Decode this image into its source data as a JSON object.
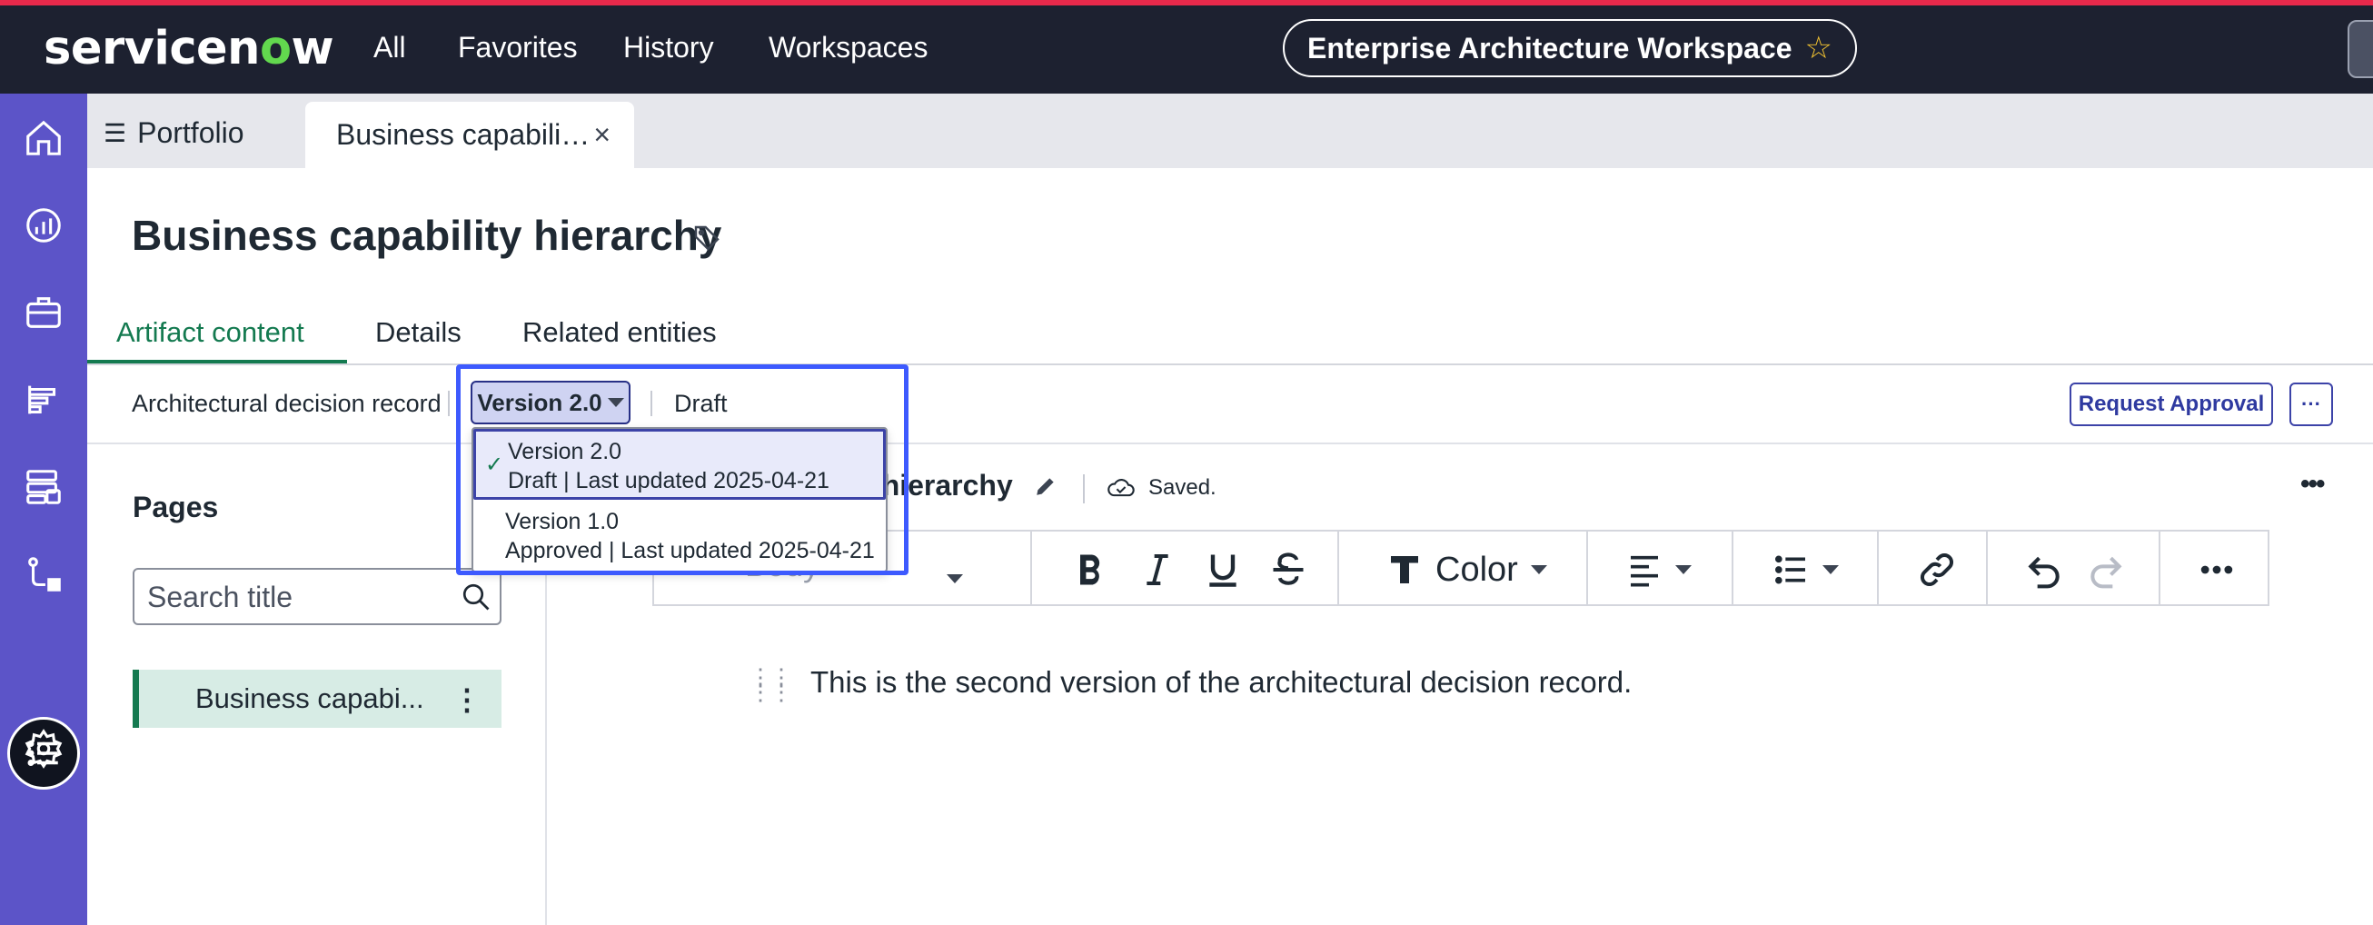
{
  "colors": {
    "accent_strip": "#e8294b",
    "topbar_bg": "#1d2130",
    "rail_bg": "#5c54c8",
    "active_tab_green": "#147a50",
    "primary_blue": "#3c43a8",
    "dropdown_highlight": "#3d5afe"
  },
  "topbar": {
    "logo_prefix": "servicen",
    "logo_o": "o",
    "logo_suffix": "w",
    "nav": [
      "All",
      "Favorites",
      "History",
      "Workspaces"
    ],
    "workspace_name": "Enterprise Architecture Workspace",
    "workspace_star_icon": "star-outline-icon"
  },
  "rail": {
    "icons": [
      "home-icon",
      "dashboard-gauge-icon",
      "briefcase-icon",
      "roadmap-icon",
      "server-list-icon",
      "flow-icon",
      "list-icon",
      "gear-icon"
    ],
    "active": "list-icon"
  },
  "tabs": {
    "portfolio": "Portfolio",
    "active": "Business capabili…",
    "close_icon": "close-icon"
  },
  "page": {
    "title": "Business capability hierarchy",
    "tag_icon": "tag-icon",
    "subtabs": [
      "Artifact content",
      "Details",
      "Related entities"
    ],
    "active_subtab": "Artifact content"
  },
  "version_bar": {
    "record_type": "Architectural decision record",
    "version_label": "Version 2.0",
    "status": "Draft",
    "request_approval": "Request Approval",
    "more": "···"
  },
  "version_dropdown": {
    "options": [
      {
        "name": "Version 2.0",
        "meta": "Draft | Last updated 2025-04-21",
        "selected": true
      },
      {
        "name": "Version 1.0",
        "meta": "Approved | Last updated 2025-04-21",
        "selected": false
      }
    ],
    "check": "✓"
  },
  "pages_panel": {
    "title": "Pages",
    "search_placeholder": "Search title",
    "items": [
      {
        "label": "Business capabi..."
      }
    ]
  },
  "editor": {
    "doc_title_fragment": "y hierarchy",
    "saved_status": "Saved.",
    "more": "•••",
    "toolbar": {
      "style_value": "Body",
      "color_label": "Color"
    },
    "body_text": "This is the second version of the architectural decision record."
  }
}
